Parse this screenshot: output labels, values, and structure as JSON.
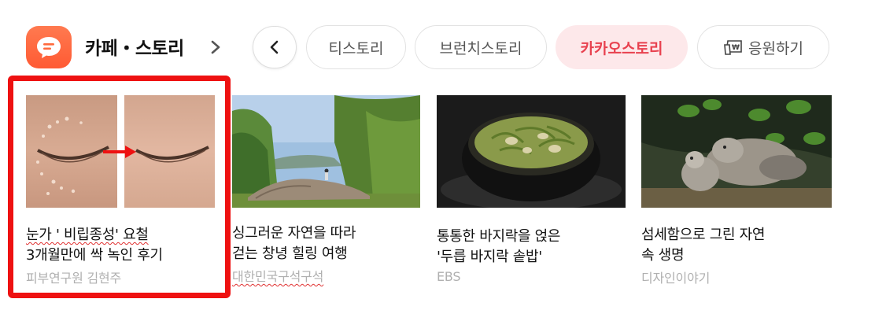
{
  "header": {
    "section_title": "카페・스토리"
  },
  "tabs": [
    {
      "label": "티스토리",
      "active": false
    },
    {
      "label": "브런치스토리",
      "active": false
    },
    {
      "label": "카카오스토리",
      "active": true
    },
    {
      "label": "응원하기",
      "active": false,
      "icon": "cheer-money-icon"
    }
  ],
  "colors": {
    "brand": "#ff6a3d",
    "active_tab_bg": "#fde8ea",
    "active_tab_text": "#e8414f",
    "highlight": "#ee1111"
  },
  "cards": [
    {
      "title_line1": "눈가 ' 비립종성' 요철",
      "title_line2": "3개월만에 싹 녹인 후기",
      "source": "피부연구원 김현주",
      "image": "eye-skin-before-after"
    },
    {
      "title_line1": "싱그러운 자연을 따라",
      "title_line2": "걷는 창녕 힐링 여행",
      "source": "대한민국구석구석",
      "image": "stone-bridge-willows"
    },
    {
      "title_line1": "통통한 바지락을 얹은",
      "title_line2": "'두릅 바지락 솥밥'",
      "source": "EBS",
      "image": "clam-rice-pot"
    },
    {
      "title_line1": "섬세함으로 그린 자연",
      "title_line2": "속 생명",
      "source": "디자인이야기",
      "image": "doves-painting"
    }
  ]
}
